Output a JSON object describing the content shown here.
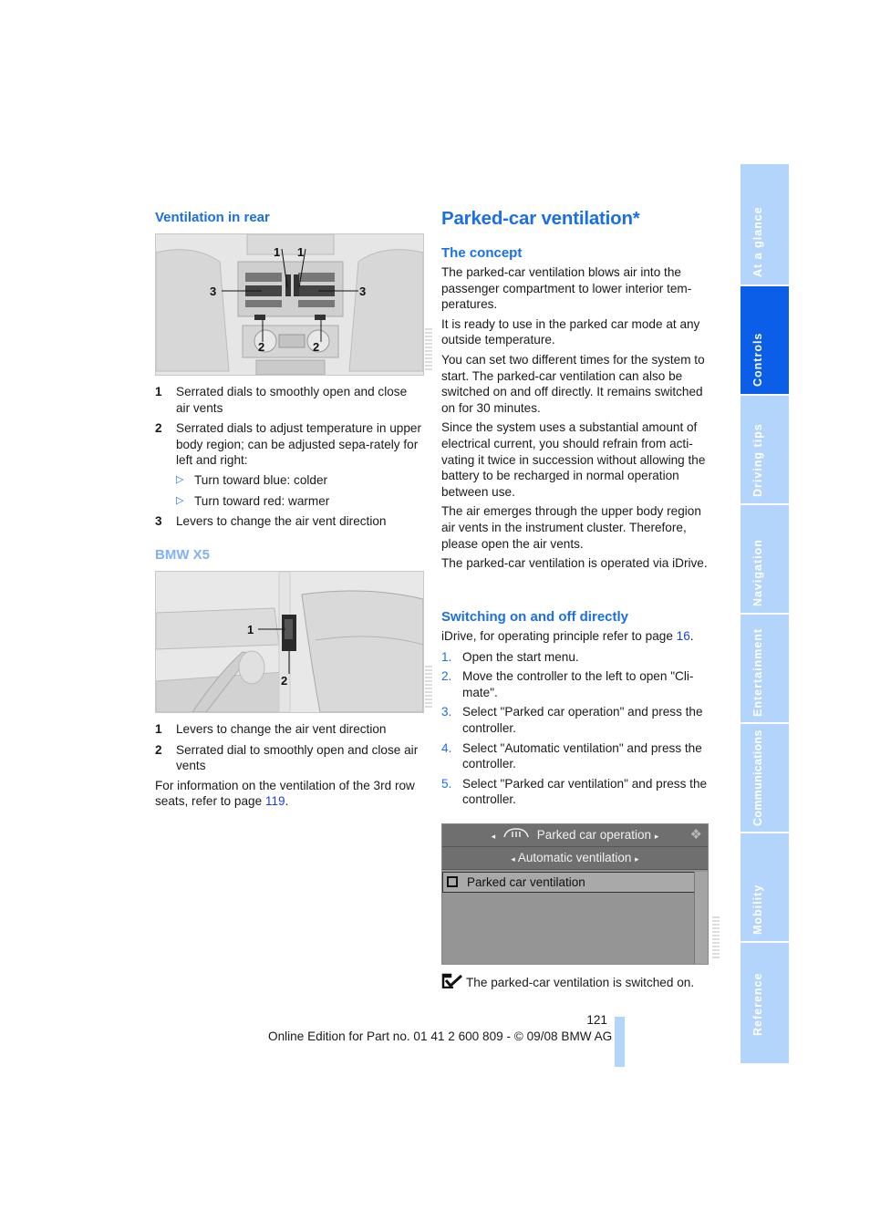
{
  "left_column": {
    "section1_heading": "Ventilation in rear",
    "figure1_callouts": [
      "1",
      "1",
      "3",
      "3",
      "2",
      "2"
    ],
    "legend1": [
      {
        "num": "1",
        "text": "Serrated dials to smoothly open and close air vents"
      },
      {
        "num": "2",
        "text": "Serrated dials to adjust temperature in upper body region; can be adjusted sepa-rately for left and right:"
      },
      {
        "num": "3",
        "text": "Levers to change the air vent direction"
      }
    ],
    "legend1_subitems": [
      {
        "text": "Turn toward blue: colder"
      },
      {
        "text": "Turn toward red: warmer"
      }
    ],
    "section2_heading": "BMW X5",
    "figure2_callouts": [
      "1",
      "2"
    ],
    "legend2": [
      {
        "num": "1",
        "text": "Levers to change the air vent direction"
      },
      {
        "num": "2",
        "text": "Serrated dial to smoothly open and close air vents"
      }
    ],
    "info_text": "For information on the ventilation of the 3rd row seats, refer to page ",
    "info_page": "119",
    "info_end": "."
  },
  "right_column": {
    "title": "Parked-car ventilation*",
    "concept_heading": "The concept",
    "concept_paragraphs": [
      "The parked-car ventilation blows air into the passenger compartment to lower interior tem-peratures.",
      "It is ready to use in the parked car mode at any outside temperature.",
      "You can set two different times for the system to start. The parked-car ventilation can also be switched on and off directly. It remains switched on for 30 minutes.",
      "Since the system uses a substantial amount of electrical current, you should refrain from acti-vating it twice in succession without allowing the battery to be recharged in normal operation between use.",
      "The air emerges through the upper body region air vents in the instrument cluster. Therefore, please open the air vents.",
      "The parked-car ventilation is operated via iDrive."
    ],
    "switching_heading": "Switching on and off directly",
    "switching_intro": "iDrive, for operating principle refer to page ",
    "switching_intro_page": "16",
    "switching_intro_end": ".",
    "steps": [
      {
        "num": "1.",
        "text": "Open the start menu."
      },
      {
        "num": "2.",
        "text": "Move the controller to the left to open \"Cli-mate\"."
      },
      {
        "num": "3.",
        "text": "Select \"Parked car operation\" and press the controller."
      },
      {
        "num": "4.",
        "text": "Select \"Automatic ventilation\" and press the controller."
      },
      {
        "num": "5.",
        "text": "Select \"Parked car ventilation\" and press the controller."
      }
    ],
    "screen": {
      "row1": "Parked car operation",
      "row2": "Automatic ventilation",
      "row3": "Parked car ventilation"
    },
    "result_text": "The parked-car ventilation is switched on."
  },
  "footer": {
    "page_number": "121",
    "edition": "Online Edition for Part no. 01 41 2 600 809 - © 09/08 BMW AG"
  },
  "side_tabs": [
    {
      "label": "At a glance",
      "active": false
    },
    {
      "label": "Controls",
      "active": true
    },
    {
      "label": "Driving tips",
      "active": false
    },
    {
      "label": "Navigation",
      "active": false
    },
    {
      "label": "Entertainment",
      "active": false
    },
    {
      "label": "Communications",
      "active": false
    },
    {
      "label": "Mobility",
      "active": false
    },
    {
      "label": "Reference",
      "active": false
    }
  ]
}
